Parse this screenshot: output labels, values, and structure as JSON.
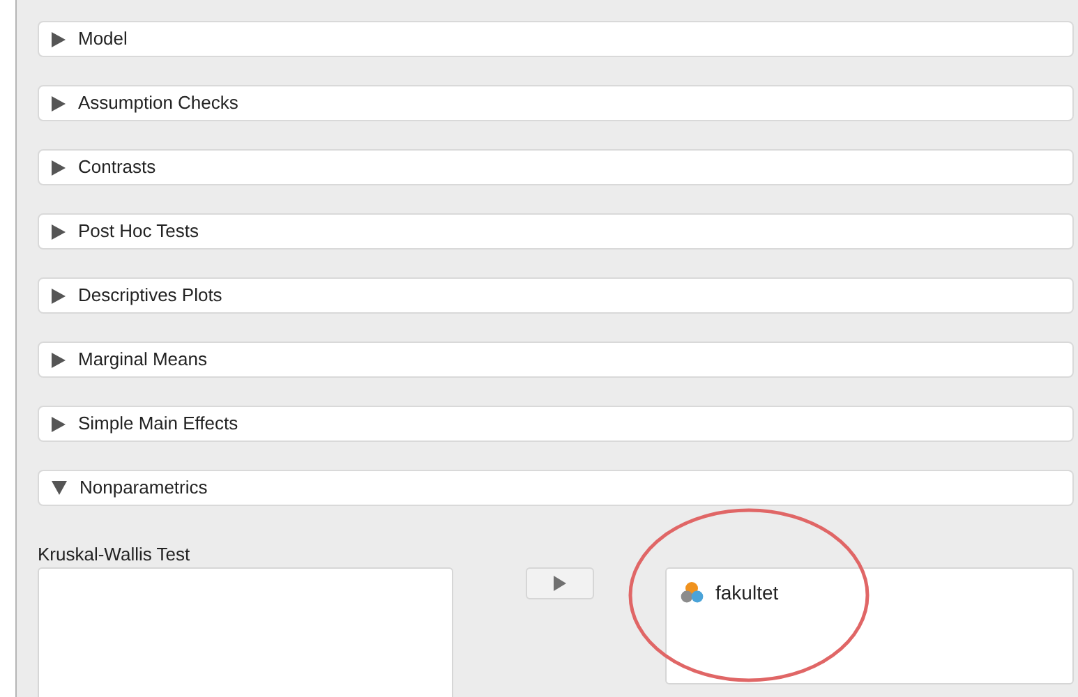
{
  "sections": [
    {
      "title": "Model",
      "expanded": false
    },
    {
      "title": "Assumption Checks",
      "expanded": false
    },
    {
      "title": "Contrasts",
      "expanded": false
    },
    {
      "title": "Post Hoc Tests",
      "expanded": false
    },
    {
      "title": "Descriptives Plots",
      "expanded": false
    },
    {
      "title": "Marginal Means",
      "expanded": false
    },
    {
      "title": "Simple Main Effects",
      "expanded": false
    },
    {
      "title": "Nonparametrics",
      "expanded": true
    }
  ],
  "nonparametrics": {
    "label": "Kruskal-Wallis Test",
    "selected_variables": [
      {
        "name": "fakultet",
        "kind": "nominal"
      }
    ]
  },
  "annotation": {
    "kind": "ellipse",
    "color": "#e06666"
  }
}
